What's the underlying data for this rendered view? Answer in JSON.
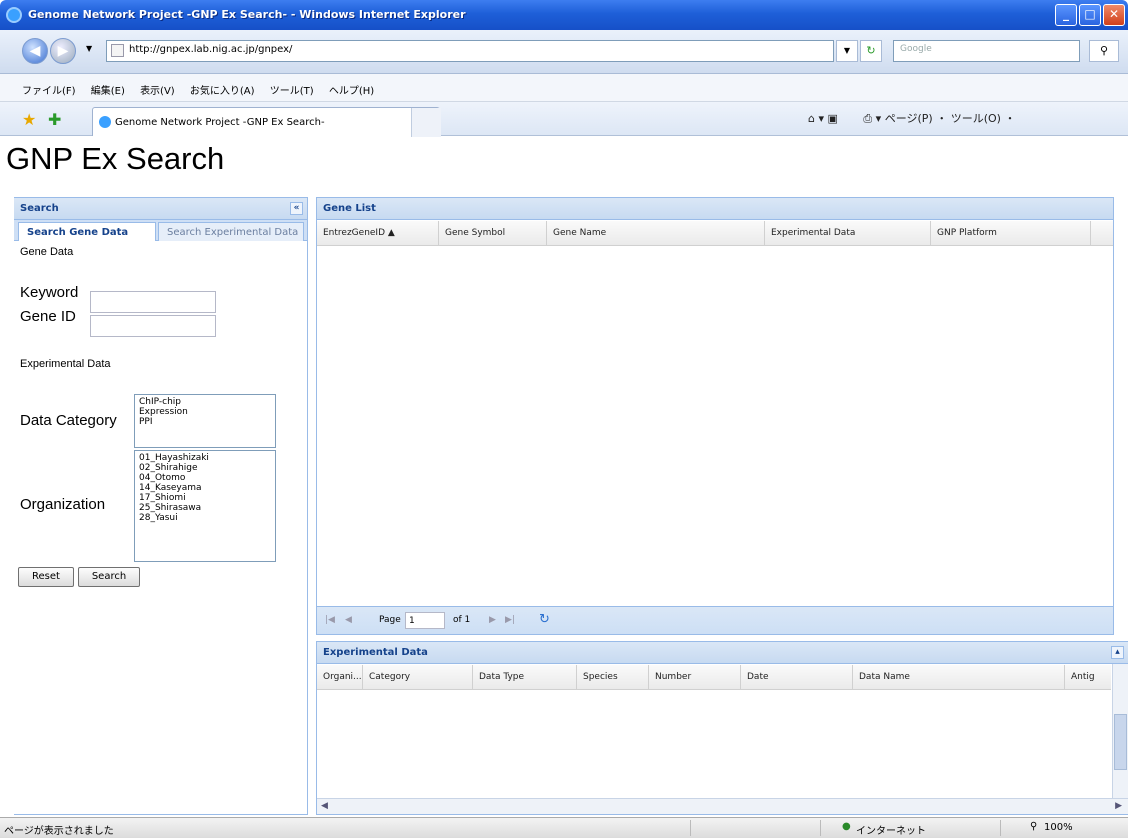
{
  "window": {
    "title": "Genome Network Project -GNP Ex Search- - Windows Internet Explorer"
  },
  "address": {
    "url": "http://gnpex.lab.nig.ac.jp/gnpex/",
    "search_placeholder": "Google"
  },
  "menu": [
    "ファイル(F)",
    "編集(E)",
    "表示(V)",
    "お気に入り(A)",
    "ツール(T)",
    "ヘルプ(H)"
  ],
  "tab": {
    "label": "Genome Network Project -GNP Ex Search-"
  },
  "command_bar": {
    "text": "ページ(P) ・ ツール(O) ・"
  },
  "page": {
    "heading": "GNP Ex Search"
  },
  "search_panel": {
    "title": "Search",
    "tabs": [
      "Search Gene Data",
      "Search Experimental Data"
    ],
    "gene_data_label": "Gene Data",
    "keyword_label": "Keyword",
    "gene_id_label": "Gene ID",
    "experimental_data_label": "Experimental Data",
    "data_category_label": "Data Category",
    "data_category_options": [
      "ChIP-chip",
      "Expression",
      "PPI"
    ],
    "organization_label": "Organization",
    "organization_options": [
      "01_Hayashizaki",
      "02_Shirahige",
      "04_Otomo",
      "14_Kaseyama",
      "17_Shiomi",
      "25_Shirasawa",
      "28_Yasui"
    ],
    "reset_label": "Reset",
    "search_label": "Search"
  },
  "gene_list": {
    "title": "Gene List",
    "columns": [
      "EntrezGeneID ▲",
      "Gene Symbol",
      "Gene Name",
      "Experimental Data",
      "GNP Platform"
    ],
    "pager": {
      "page_label": "Page",
      "page_value": "1",
      "of_label": "of 1"
    }
  },
  "experimental_data": {
    "title": "Experimental Data",
    "columns": [
      "Organi...",
      "Category",
      "Data Type",
      "Species",
      "Number",
      "Date",
      "Data Name",
      "Antig"
    ]
  },
  "status": {
    "left": "ページが表示されました",
    "zone": "インターネット",
    "zoom": "100%"
  }
}
